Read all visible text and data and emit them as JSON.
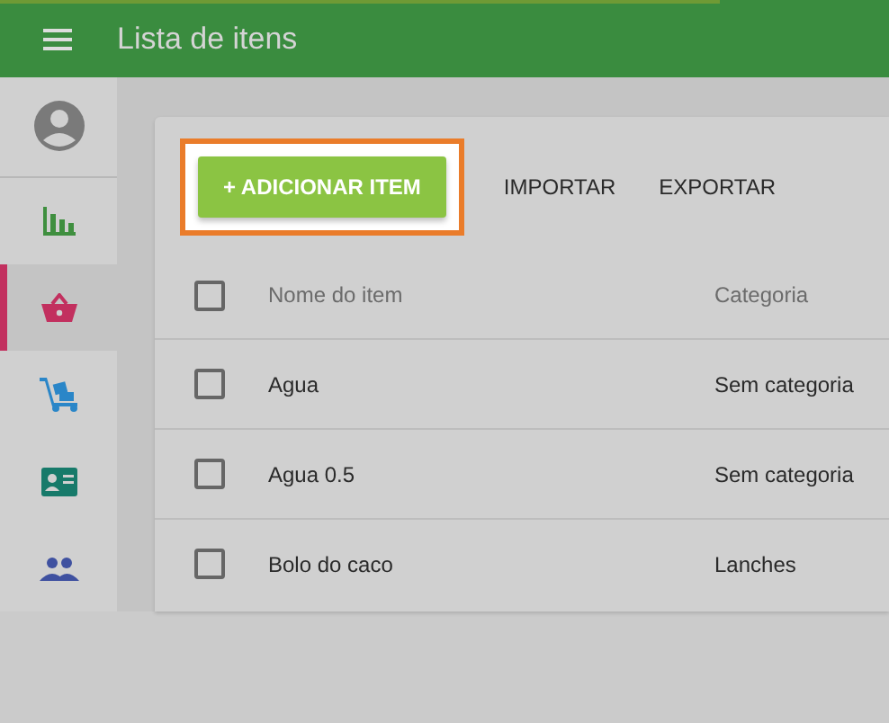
{
  "app_bar": {
    "title": "Lista de itens"
  },
  "sidebar": {
    "items": [
      {
        "kind": "chart",
        "selected": false
      },
      {
        "kind": "basket",
        "selected": true
      },
      {
        "kind": "cart",
        "selected": false
      },
      {
        "kind": "idcard",
        "selected": false
      },
      {
        "kind": "people",
        "selected": false
      }
    ]
  },
  "toolbar": {
    "primary": {
      "label": "+ ADICIONAR ITEM",
      "highlighted": true
    },
    "actions": [
      "IMPORTAR",
      "EXPORTAR"
    ]
  },
  "table": {
    "select_all_checked": false,
    "columns": [
      "Nome do item",
      "Categoria"
    ],
    "rows": [
      {
        "checked": false,
        "cells": [
          "Agua",
          "Sem categoria"
        ]
      },
      {
        "checked": false,
        "cells": [
          "Agua 0.5",
          "Sem categoria"
        ]
      },
      {
        "checked": false,
        "cells": [
          "Bolo do caco",
          "Lanches"
        ]
      }
    ]
  }
}
